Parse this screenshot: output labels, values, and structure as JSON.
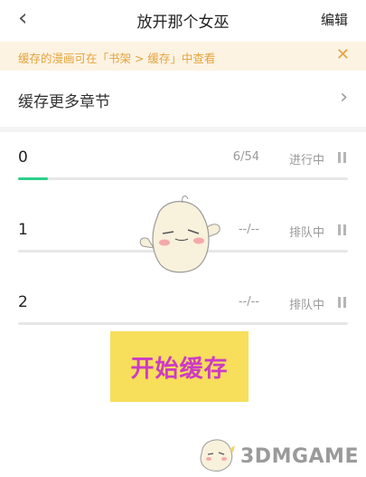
{
  "header": {
    "title": "放开那个女巫",
    "edit_label": "编辑",
    "back_glyph": "‹"
  },
  "notice": {
    "text": "缓存的漫画可在「书架 > 缓存」中查看",
    "close_glyph": "✕"
  },
  "more_chapters": {
    "label": "缓存更多章节",
    "arrow_glyph": "›"
  },
  "items": [
    {
      "name": "0",
      "progress": "6/54",
      "status": "进行中",
      "fill": 0.09
    },
    {
      "name": "1",
      "progress": "--/--",
      "status": "排队中",
      "fill": 0
    },
    {
      "name": "2",
      "progress": "--/--",
      "status": "排队中",
      "fill": 0
    }
  ],
  "start_button": {
    "label": "开始缓存"
  },
  "watermark": {
    "text": "3DMGAME"
  },
  "colors": {
    "accent_green": "#2dcf8a",
    "notice_text": "#e3a33d",
    "notice_bg": "#fdf3e3",
    "button_bg": "#f7de5b",
    "button_text": "#cc3cc4"
  }
}
